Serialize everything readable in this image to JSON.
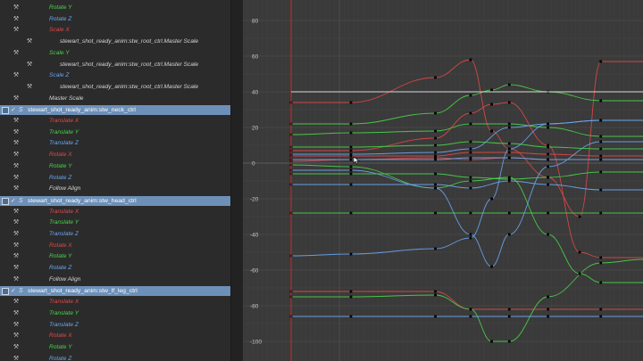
{
  "colors": {
    "x_channel": "#e04848",
    "y_channel": "#49d249",
    "z_channel": "#6aa6f0",
    "neutral_text": "#d6d6d6",
    "group_bg": "#6d90b8",
    "graph_bg": "#3a3a3a",
    "current_time_line": "#c82828"
  },
  "outliner": {
    "rows": [
      {
        "kind": "attr",
        "label": "Rotate Y",
        "channel": "y",
        "indent": 1
      },
      {
        "kind": "attr",
        "label": "Rotate Z",
        "channel": "z",
        "indent": 1
      },
      {
        "kind": "attr",
        "label": "Scale X",
        "channel": "x",
        "indent": 1
      },
      {
        "kind": "attr",
        "label": "stewart_shot_ready_anim:stw_root_ctrl.Master Scale",
        "channel": "neutral",
        "indent": 2
      },
      {
        "kind": "attr",
        "label": "Scale Y",
        "channel": "y",
        "indent": 1
      },
      {
        "kind": "attr",
        "label": "stewart_shot_ready_anim:stw_root_ctrl.Master Scale",
        "channel": "neutral",
        "indent": 2
      },
      {
        "kind": "attr",
        "label": "Scale Z",
        "channel": "z",
        "indent": 1
      },
      {
        "kind": "attr",
        "label": "stewart_shot_ready_anim:stw_root_ctrl.Master Scale",
        "channel": "neutral",
        "indent": 2
      },
      {
        "kind": "attr",
        "label": "Master Scale",
        "channel": "neutral",
        "indent": 1
      },
      {
        "kind": "group",
        "label": "stewart_shot_ready_anim:stw_neck_ctrl"
      },
      {
        "kind": "attr",
        "label": "Translate X",
        "channel": "x",
        "indent": 1
      },
      {
        "kind": "attr",
        "label": "Translate Y",
        "channel": "y",
        "indent": 1
      },
      {
        "kind": "attr",
        "label": "Translate Z",
        "channel": "z",
        "indent": 1
      },
      {
        "kind": "attr",
        "label": "Rotate X",
        "channel": "x",
        "indent": 1
      },
      {
        "kind": "attr",
        "label": "Rotate Y",
        "channel": "y",
        "indent": 1
      },
      {
        "kind": "attr",
        "label": "Rotate Z",
        "channel": "z",
        "indent": 1
      },
      {
        "kind": "attr",
        "label": "Follow Align",
        "channel": "neutral",
        "indent": 1
      },
      {
        "kind": "group",
        "label": "stewart_shot_ready_anim:stw_head_ctrl"
      },
      {
        "kind": "attr",
        "label": "Translate X",
        "channel": "x",
        "indent": 1
      },
      {
        "kind": "attr",
        "label": "Translate Y",
        "channel": "y",
        "indent": 1
      },
      {
        "kind": "attr",
        "label": "Translate Z",
        "channel": "z",
        "indent": 1
      },
      {
        "kind": "attr",
        "label": "Rotate X",
        "channel": "x",
        "indent": 1
      },
      {
        "kind": "attr",
        "label": "Rotate Y",
        "channel": "y",
        "indent": 1
      },
      {
        "kind": "attr",
        "label": "Rotate Z",
        "channel": "z",
        "indent": 1
      },
      {
        "kind": "attr",
        "label": "Follow Align",
        "channel": "neutral",
        "indent": 1
      },
      {
        "kind": "group",
        "label": "stewart_shot_ready_anim:stw_lf_leg_ctrl"
      },
      {
        "kind": "attr",
        "label": "Translate X",
        "channel": "x",
        "indent": 1
      },
      {
        "kind": "attr",
        "label": "Translate Y",
        "channel": "y",
        "indent": 1
      },
      {
        "kind": "attr",
        "label": "Translate Z",
        "channel": "z",
        "indent": 1
      },
      {
        "kind": "attr",
        "label": "Rotate X",
        "channel": "x",
        "indent": 1
      },
      {
        "kind": "attr",
        "label": "Rotate Y",
        "channel": "y",
        "indent": 1
      },
      {
        "kind": "attr",
        "label": "Rotate Z",
        "channel": "z",
        "indent": 1
      }
    ]
  },
  "graph": {
    "y_ticks": [
      80,
      60,
      40,
      20,
      0,
      -20,
      -40,
      -60,
      -80,
      -100
    ],
    "y_range": [
      -105,
      88
    ],
    "key_frames": [
      0,
      17,
      41,
      51,
      57,
      62,
      73,
      88
    ]
  },
  "chart_data": {
    "type": "line",
    "xlabel": "",
    "ylabel": "",
    "ylim": [
      -105,
      88
    ],
    "y_ticks": [
      80,
      60,
      40,
      20,
      0,
      -20,
      -40,
      -60,
      -80,
      -100
    ],
    "grid": true,
    "series": [
      {
        "channel": "x",
        "points": [
          [
            0,
            34
          ],
          [
            17,
            34
          ],
          [
            41,
            48
          ],
          [
            51,
            58
          ],
          [
            57,
            18
          ],
          [
            62,
            8
          ],
          [
            73,
            -8
          ],
          [
            82,
            -30
          ],
          [
            88,
            57
          ],
          [
            100,
            57
          ]
        ]
      },
      {
        "channel": "x",
        "points": [
          [
            0,
            7
          ],
          [
            17,
            7
          ],
          [
            41,
            14
          ],
          [
            51,
            28
          ],
          [
            57,
            33
          ],
          [
            62,
            34
          ],
          [
            73,
            10
          ],
          [
            82,
            -50
          ],
          [
            88,
            -53
          ],
          [
            100,
            -53
          ]
        ]
      },
      {
        "channel": "x",
        "points": [
          [
            0,
            4
          ],
          [
            17,
            4
          ],
          [
            41,
            4
          ],
          [
            51,
            6
          ],
          [
            62,
            6
          ],
          [
            73,
            5
          ],
          [
            88,
            4
          ],
          [
            100,
            4
          ]
        ]
      },
      {
        "channel": "x",
        "points": [
          [
            0,
            1
          ],
          [
            17,
            2
          ],
          [
            41,
            3
          ],
          [
            51,
            2
          ],
          [
            62,
            3
          ],
          [
            73,
            2
          ],
          [
            88,
            2
          ],
          [
            100,
            2
          ]
        ]
      },
      {
        "channel": "x",
        "points": [
          [
            0,
            -72
          ],
          [
            17,
            -72
          ],
          [
            41,
            -72
          ],
          [
            51,
            -82
          ],
          [
            62,
            -82
          ],
          [
            73,
            -82
          ],
          [
            88,
            -82
          ],
          [
            100,
            -82
          ]
        ]
      },
      {
        "channel": "y",
        "points": [
          [
            0,
            22
          ],
          [
            17,
            22
          ],
          [
            41,
            28
          ],
          [
            51,
            38
          ],
          [
            57,
            41
          ],
          [
            62,
            44
          ],
          [
            73,
            40
          ],
          [
            88,
            35
          ],
          [
            100,
            35
          ]
        ]
      },
      {
        "channel": "y",
        "points": [
          [
            0,
            16
          ],
          [
            17,
            17
          ],
          [
            41,
            18
          ],
          [
            51,
            22
          ],
          [
            62,
            22
          ],
          [
            73,
            20
          ],
          [
            88,
            15
          ],
          [
            100,
            15
          ]
        ]
      },
      {
        "channel": "y",
        "points": [
          [
            0,
            9
          ],
          [
            17,
            9
          ],
          [
            41,
            10
          ],
          [
            51,
            12
          ],
          [
            62,
            11
          ],
          [
            73,
            9
          ],
          [
            88,
            8
          ],
          [
            100,
            8
          ]
        ]
      },
      {
        "channel": "y",
        "points": [
          [
            0,
            -6
          ],
          [
            17,
            -6
          ],
          [
            41,
            -6
          ],
          [
            51,
            -8
          ],
          [
            62,
            -9
          ],
          [
            73,
            -8
          ],
          [
            88,
            -5
          ],
          [
            100,
            -5
          ]
        ]
      },
      {
        "channel": "y",
        "points": [
          [
            0,
            -28
          ],
          [
            17,
            -28
          ],
          [
            41,
            -28
          ],
          [
            51,
            -28
          ],
          [
            62,
            -28
          ],
          [
            73,
            -28
          ],
          [
            88,
            -28
          ],
          [
            100,
            -28
          ]
        ]
      },
      {
        "channel": "y",
        "points": [
          [
            0,
            -75
          ],
          [
            17,
            -75
          ],
          [
            41,
            -74
          ],
          [
            51,
            -82
          ],
          [
            57,
            -100
          ],
          [
            62,
            -100
          ],
          [
            73,
            -75
          ],
          [
            88,
            -56
          ],
          [
            100,
            -54
          ]
        ]
      },
      {
        "channel": "y",
        "points": [
          [
            0,
            -1
          ],
          [
            17,
            -2
          ],
          [
            41,
            -14
          ],
          [
            51,
            -10
          ],
          [
            62,
            -8
          ],
          [
            73,
            -40
          ],
          [
            82,
            -62
          ],
          [
            88,
            -67
          ],
          [
            100,
            -67
          ]
        ]
      },
      {
        "channel": "z",
        "points": [
          [
            0,
            -52
          ],
          [
            17,
            -51
          ],
          [
            41,
            -48
          ],
          [
            51,
            -42
          ],
          [
            57,
            -20
          ],
          [
            62,
            8
          ],
          [
            73,
            22
          ],
          [
            88,
            24
          ],
          [
            100,
            24
          ]
        ]
      },
      {
        "channel": "z",
        "points": [
          [
            0,
            -12
          ],
          [
            17,
            -12
          ],
          [
            41,
            -12
          ],
          [
            51,
            -14
          ],
          [
            62,
            -10
          ],
          [
            73,
            -12
          ],
          [
            88,
            -15
          ],
          [
            100,
            -15
          ]
        ]
      },
      {
        "channel": "z",
        "points": [
          [
            0,
            2
          ],
          [
            17,
            2
          ],
          [
            41,
            2
          ],
          [
            51,
            3
          ],
          [
            62,
            3
          ],
          [
            73,
            2
          ],
          [
            88,
            2
          ],
          [
            100,
            2
          ]
        ]
      },
      {
        "channel": "z",
        "points": [
          [
            0,
            -86
          ],
          [
            17,
            -86
          ],
          [
            41,
            -86
          ],
          [
            51,
            -86
          ],
          [
            62,
            -86
          ],
          [
            73,
            -86
          ],
          [
            88,
            -86
          ],
          [
            100,
            -86
          ]
        ]
      },
      {
        "channel": "z",
        "points": [
          [
            0,
            -4
          ],
          [
            17,
            -4
          ],
          [
            41,
            -14
          ],
          [
            51,
            -40
          ],
          [
            57,
            -58
          ],
          [
            62,
            -40
          ],
          [
            73,
            -2
          ],
          [
            88,
            12
          ],
          [
            100,
            12
          ]
        ]
      },
      {
        "channel": "z",
        "points": [
          [
            0,
            5
          ],
          [
            17,
            5
          ],
          [
            41,
            6
          ],
          [
            51,
            8
          ],
          [
            62,
            20
          ],
          [
            73,
            22
          ],
          [
            88,
            24
          ],
          [
            100,
            24
          ]
        ]
      }
    ]
  }
}
